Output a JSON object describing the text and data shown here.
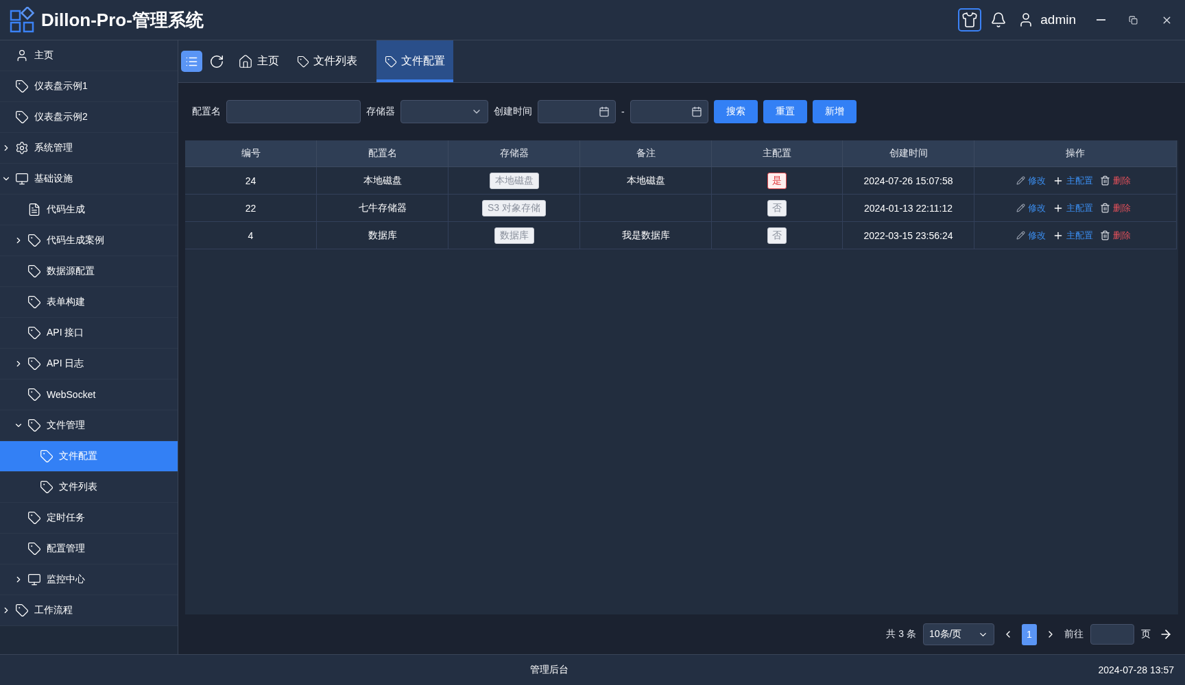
{
  "header": {
    "title": "Dillon-Pro-管理系统",
    "user": "admin"
  },
  "sidebar": {
    "items": [
      {
        "label": "主页",
        "kind": "user",
        "selected": false
      },
      {
        "label": "仪表盘示例1",
        "kind": "tag",
        "selected": false
      },
      {
        "label": "仪表盘示例2",
        "kind": "tag",
        "selected": false
      },
      {
        "label": "系统管理",
        "kind": "gear",
        "selected": false,
        "expanded": false
      },
      {
        "label": "基础设施",
        "kind": "monitor",
        "selected": false,
        "expanded": true,
        "children": [
          {
            "label": "代码生成",
            "kind": "document",
            "selected": false
          },
          {
            "label": "代码生成案例",
            "kind": "tag",
            "selected": false,
            "expanded": false
          },
          {
            "label": "数据源配置",
            "kind": "tag",
            "selected": false
          },
          {
            "label": "表单构建",
            "kind": "tag",
            "selected": false
          },
          {
            "label": "API 接口",
            "kind": "tag",
            "selected": false
          },
          {
            "label": "API 日志",
            "kind": "tag",
            "selected": false,
            "expanded": false
          },
          {
            "label": "WebSocket",
            "kind": "tag",
            "selected": false
          },
          {
            "label": "文件管理",
            "kind": "tag",
            "selected": false,
            "expanded": true,
            "children": [
              {
                "label": "文件配置",
                "kind": "tag",
                "selected": true
              },
              {
                "label": "文件列表",
                "kind": "tag",
                "selected": false
              }
            ]
          },
          {
            "label": "定时任务",
            "kind": "tag",
            "selected": false
          },
          {
            "label": "配置管理",
            "kind": "tag",
            "selected": false
          },
          {
            "label": "监控中心",
            "kind": "monitor",
            "selected": false,
            "expanded": false
          }
        ]
      },
      {
        "label": "工作流程",
        "kind": "tag",
        "selected": false,
        "expanded": false
      }
    ]
  },
  "tabs": [
    {
      "label": "主页",
      "kind": "home",
      "selected": false
    },
    {
      "label": "文件列表",
      "kind": "tag",
      "selected": false
    },
    {
      "label": "文件配置",
      "kind": "tag",
      "selected": true
    }
  ],
  "filters": {
    "name_label": "配置名",
    "storage_label": "存储器",
    "time_label": "创建时间",
    "range_separator": "-",
    "buttons": [
      "搜索",
      "重置",
      "新增"
    ]
  },
  "table": {
    "columns": [
      "编号",
      "配置名",
      "存储器",
      "备注",
      "主配置",
      "创建时间",
      "操作"
    ],
    "rows": [
      {
        "id": "24",
        "name": "本地磁盘",
        "storage": "本地磁盘",
        "remark": "本地磁盘",
        "primary": {
          "text": "是",
          "on": true
        },
        "created": "2024-07-26 15:07:58",
        "actions": [
          {
            "label": "修改",
            "kind": "edit"
          },
          {
            "label": "主配置",
            "kind": "add"
          },
          {
            "label": "删除",
            "kind": "delete"
          }
        ]
      },
      {
        "id": "22",
        "name": "七牛存储器",
        "storage": "S3 对象存储",
        "remark": "",
        "primary": {
          "text": "否",
          "on": false
        },
        "created": "2024-01-13 22:11:12",
        "actions": [
          {
            "label": "修改",
            "kind": "edit"
          },
          {
            "label": "主配置",
            "kind": "add"
          },
          {
            "label": "删除",
            "kind": "delete"
          }
        ]
      },
      {
        "id": "4",
        "name": "数据库",
        "storage": "数据库",
        "remark": "我是数据库",
        "primary": {
          "text": "否",
          "on": false
        },
        "created": "2022-03-15 23:56:24",
        "actions": [
          {
            "label": "修改",
            "kind": "edit"
          },
          {
            "label": "主配置",
            "kind": "add"
          },
          {
            "label": "删除",
            "kind": "delete"
          }
        ]
      }
    ]
  },
  "pagination": {
    "total": "共 3 条",
    "page_size": "10条/页",
    "pages": [
      {
        "label": "1",
        "selected": true
      }
    ],
    "goto_label": "前往",
    "goto_suffix": "页"
  },
  "footer": {
    "center": "管理后台",
    "time": "2024-07-28 13:57"
  }
}
